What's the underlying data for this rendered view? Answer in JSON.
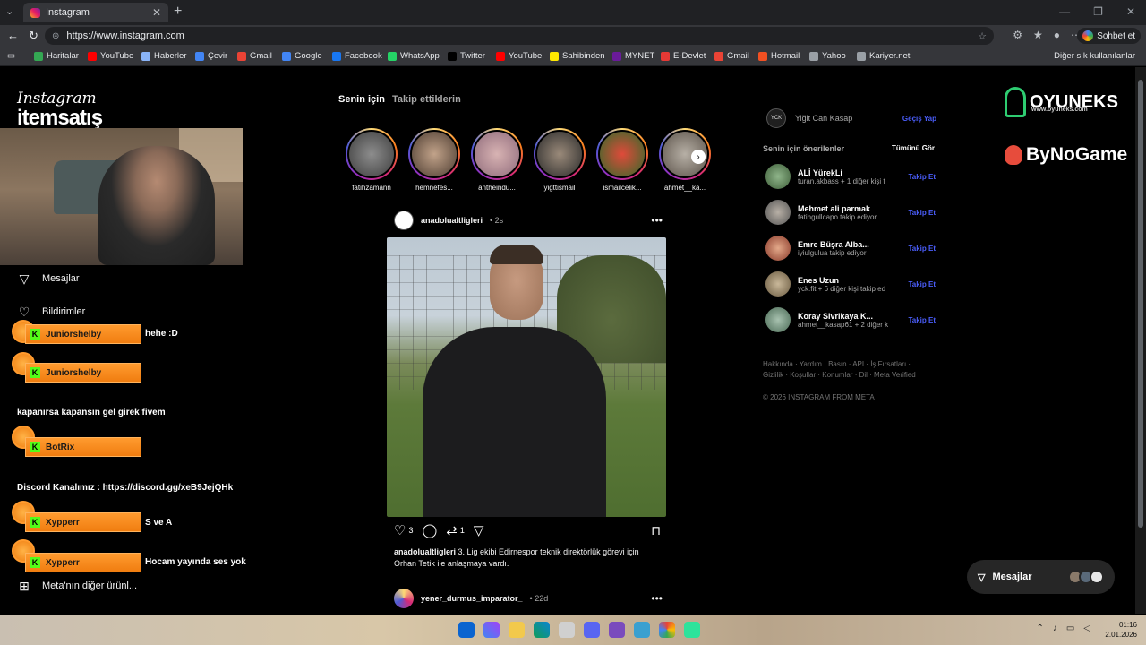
{
  "browser": {
    "tab_title": "Instagram",
    "url": "https://www.instagram.com",
    "chat_button": "Sohbet et",
    "bookmarks": [
      {
        "label": "Haritalar",
        "icon": "maps-icon",
        "color": "#34a853"
      },
      {
        "label": "YouTube",
        "icon": "youtube-icon",
        "color": "#ff0000"
      },
      {
        "label": "Haberler",
        "icon": "news-icon",
        "color": "#8ab4f8"
      },
      {
        "label": "Çevir",
        "icon": "translate-icon",
        "color": "#4285f4"
      },
      {
        "label": "Gmail",
        "icon": "google-icon",
        "color": "#ea4335"
      },
      {
        "label": "Google",
        "icon": "google-icon",
        "color": "#4285f4"
      },
      {
        "label": "Facebook",
        "icon": "facebook-icon",
        "color": "#1877f2"
      },
      {
        "label": "WhatsApp",
        "icon": "whatsapp-icon",
        "color": "#25d366"
      },
      {
        "label": "Twitter",
        "icon": "x-icon",
        "color": "#000000"
      },
      {
        "label": "YouTube",
        "icon": "youtube-icon",
        "color": "#ff0000"
      },
      {
        "label": "Sahibinden",
        "icon": "sahibinden-icon",
        "color": "#ffe800"
      },
      {
        "label": "MYNET",
        "icon": "mynet-icon",
        "color": "#6a1b9a"
      },
      {
        "label": "E-Devlet",
        "icon": "edevlet-icon",
        "color": "#e53935"
      },
      {
        "label": "Gmail",
        "icon": "google-icon",
        "color": "#ea4335"
      },
      {
        "label": "Hotmail",
        "icon": "microsoft-icon",
        "color": "#f25022"
      },
      {
        "label": "Yahoo",
        "icon": "globe-icon",
        "color": "#9aa0a6"
      },
      {
        "label": "Kariyer.net",
        "icon": "globe-icon",
        "color": "#9aa0a6"
      }
    ],
    "other_bookmarks": "Diğer sık kullanılanlar"
  },
  "overlay": {
    "ig_logo": "Instagram",
    "sponsor": "itemsatış",
    "sponsor_right_1": "OYUNEKS",
    "sponsor_right_1_sub": "www.oyuneks.com",
    "sponsor_right_2": "ByNoGame"
  },
  "sidebar": {
    "messages": "Mesajlar",
    "notifications": "Bildirimler",
    "more": "Meta'nın diğer ürünl..."
  },
  "chat": [
    {
      "user": "Juniorshelby",
      "message": "hehe :D"
    },
    {
      "user": "Juniorshelby",
      "message": ""
    },
    {
      "user": "",
      "message": "kapanırsa kapansın gel girek fivem"
    },
    {
      "user": "BotRix",
      "message": ""
    },
    {
      "user": "",
      "message": "Discord Kanalımız : https://discord.gg/xeB9JejQHk"
    },
    {
      "user": "Xypperr",
      "message": "S ve A"
    },
    {
      "user": "Xypperr",
      "message": "Hocam yayında ses yok"
    }
  ],
  "feed": {
    "tab_active": "Senin için",
    "tab_inactive": "Takip ettiklerin",
    "stories": [
      "fatihzamann",
      "hemnefes...",
      "antheindu...",
      "yigttismail",
      "ismailcelik...",
      "ahmet__ka..."
    ],
    "post": {
      "username": "anadolualtligleri",
      "time": "• 2s",
      "likes": "3",
      "reposts": "1",
      "caption_user": "anadolualtligleri",
      "caption": "3. Lig ekibi Edirnespor teknik direktörlük görevi için Orhan Tetik ile anlaşmaya vardı."
    },
    "next_post": {
      "username": "yener_durmus_imparator_",
      "time": "• 22d"
    }
  },
  "right": {
    "current_user_name": "Yiğit Can Kasap",
    "switch": "Geçiş Yap",
    "suggestions_title": "Senin için önerilenler",
    "see_all": "Tümünü Gör",
    "suggestions": [
      {
        "name": "ALİ YürekLi",
        "sub": "turan.akbass + 1 diğer kişi t",
        "action": "Takip Et"
      },
      {
        "name": "Mehmet ali parmak",
        "sub": "fatihgullcapo takip ediyor",
        "action": "Takip Et"
      },
      {
        "name": "Emre Büşra Alba...",
        "sub": "iyiulgulua takip ediyor",
        "action": "Takip Et"
      },
      {
        "name": "Enes Uzun",
        "sub": "yck.fit + 6 diğer kişi takip ed",
        "action": "Takip Et"
      },
      {
        "name": "Koray Sivrikaya K...",
        "sub": "ahmet__kasap61 + 2 diğer k",
        "action": "Takip Et"
      }
    ],
    "footer": "Hakkında · Yardım · Basın · API · İş Fırsatları · Gizlilik · Koşullar · Konumlar · Dil · Meta Verified",
    "copyright": "© 2026 INSTAGRAM FROM META",
    "messages_float": "Mesajlar"
  },
  "taskbar": {
    "time": "01:16",
    "date": "2.01.2026"
  }
}
